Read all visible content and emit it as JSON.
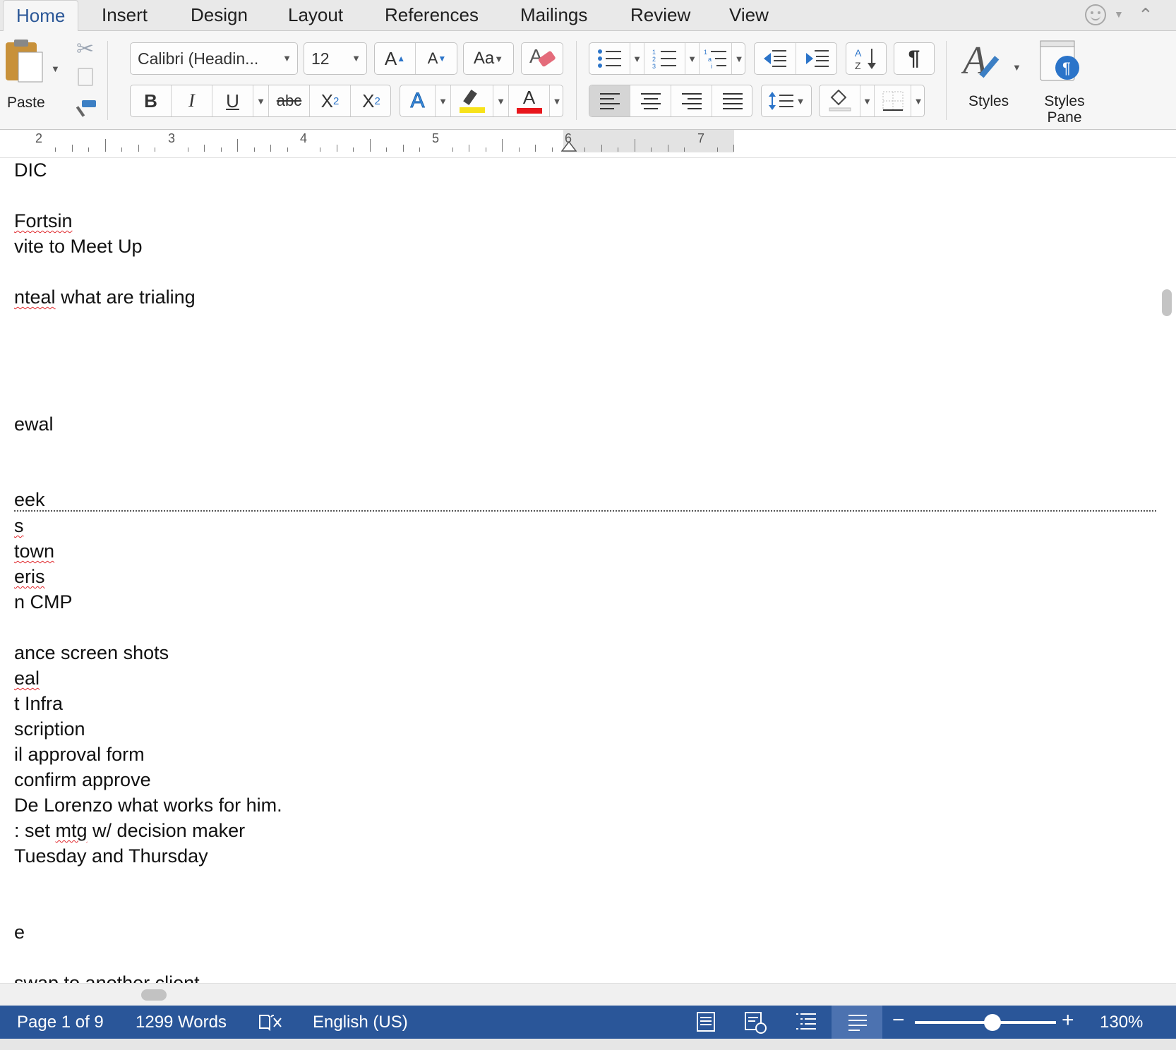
{
  "tabs": [
    {
      "label": "Home"
    },
    {
      "label": "Insert"
    },
    {
      "label": "Design"
    },
    {
      "label": "Layout"
    },
    {
      "label": "References"
    },
    {
      "label": "Mailings"
    },
    {
      "label": "Review"
    },
    {
      "label": "View"
    }
  ],
  "active_tab": "Home",
  "clipboard": {
    "paste_label": "Paste"
  },
  "font": {
    "name": "Calibri (Headin...",
    "size": "12"
  },
  "format_buttons": {
    "bold": "B",
    "italic": "I",
    "underline": "U",
    "strikethrough": "abc",
    "subscript_base": "X",
    "subscript_mark": "2",
    "superscript_base": "X",
    "superscript_mark": "2"
  },
  "font_color_accent": "#e8161c",
  "highlight_color": "#f7e21a",
  "styles": {
    "styles_label": "Styles",
    "styles_pane_line1": "Styles",
    "styles_pane_line2": "Pane"
  },
  "ruler": {
    "numbers": [
      "2",
      "3",
      "4",
      "5",
      "6",
      "7"
    ]
  },
  "document_lines": [
    {
      "text": "DIC",
      "spell": false
    },
    {
      "text": "Fortsin",
      "spell": true
    },
    {
      "text": "vite to Meet Up",
      "spell": false
    },
    {
      "pre": "",
      "spell_word": "nteal",
      "post": " what are trialing"
    },
    {
      "text": "ewal",
      "spell": false
    },
    {
      "text": "eek",
      "spell": false
    },
    {
      "text": "s",
      "spell": true
    },
    {
      "text": "town",
      "spell": true
    },
    {
      "text": "eris",
      "spell": true
    },
    {
      "text": "n CMP",
      "spell": false
    },
    {
      "text": "ance screen shots",
      "spell": false
    },
    {
      "text": "eal",
      "spell": true
    },
    {
      "text": "t Infra",
      "spell": false
    },
    {
      "text": "scription",
      "spell": false
    },
    {
      "text": "il approval form",
      "spell": false
    },
    {
      "text": "confirm approve",
      "spell": false
    },
    {
      "text": " De Lorenzo what works for him.",
      "spell": false
    },
    {
      "pre": ": set ",
      "spell_word": "mtg",
      "post": " w/ decision maker"
    },
    {
      "text": "Tuesday and Thursday",
      "spell": false
    },
    {
      "text": "e",
      "spell": false
    },
    {
      "text": "swap to another client",
      "spell": false
    }
  ],
  "status_bar": {
    "page": "Page 1 of 9",
    "words": "1299 Words",
    "language": "English (US)",
    "zoom": "130%",
    "zoom_minus": "−",
    "zoom_plus": "+",
    "zoom_level_fraction": 0.55
  },
  "colors": {
    "status_bar": "#2a5699",
    "tab_active": "#2b5797",
    "spellcheck": "#e0262b"
  }
}
